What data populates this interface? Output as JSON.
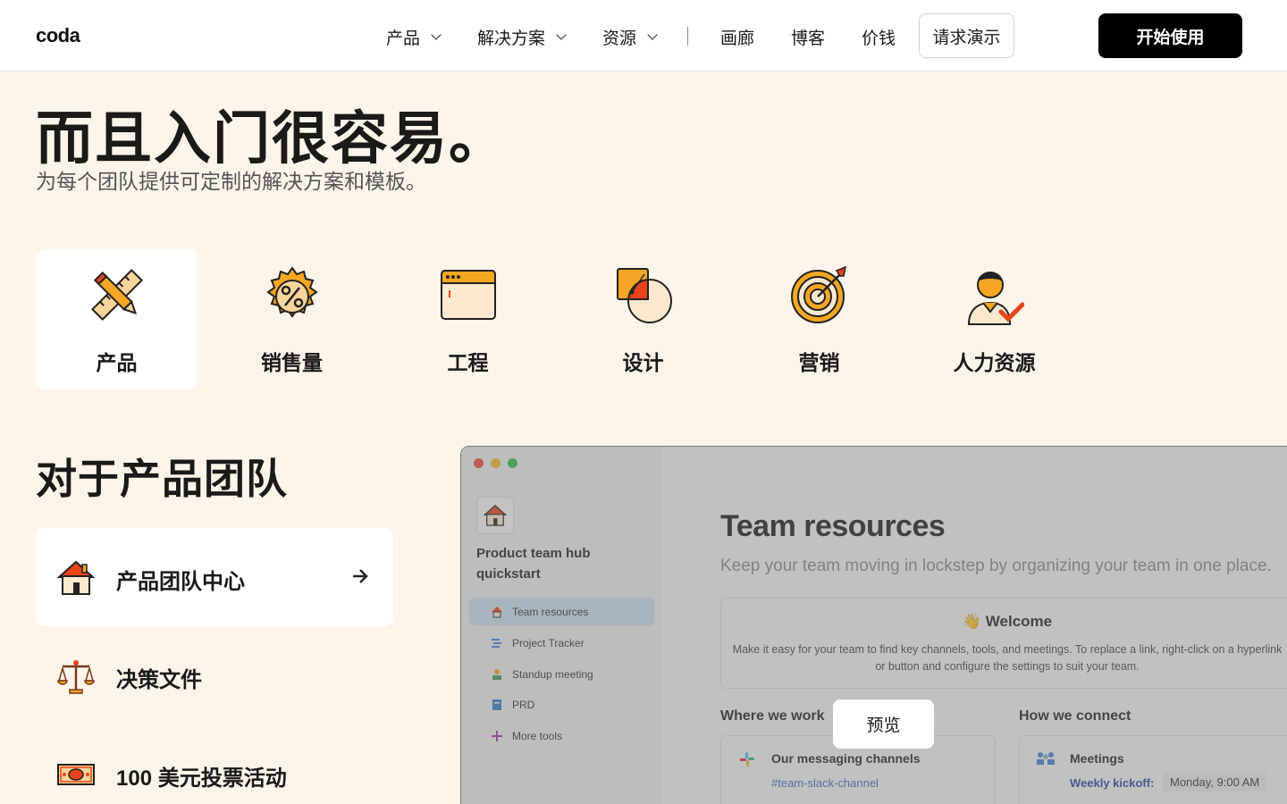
{
  "nav": {
    "logo": "coda",
    "items": [
      {
        "label": "产品"
      },
      {
        "label": "解决方案"
      },
      {
        "label": "资源"
      },
      {
        "label": "画廊"
      },
      {
        "label": "博客"
      },
      {
        "label": "价钱"
      }
    ],
    "demo_label": "请求演示",
    "start_label": "开始使用"
  },
  "hero": {
    "title": "而且入门很容易。",
    "subtitle": "为每个团队提供可定制的解决方案和模板。"
  },
  "categories": [
    {
      "label": "产品",
      "icon": "pencil-ruler-icon",
      "selected": true
    },
    {
      "label": "销售量",
      "icon": "percent-gear-icon"
    },
    {
      "label": "工程",
      "icon": "browser-window-icon"
    },
    {
      "label": "设计",
      "icon": "shapes-icon"
    },
    {
      "label": "营销",
      "icon": "target-icon"
    },
    {
      "label": "人力资源",
      "icon": "person-check-icon"
    }
  ],
  "section_title": "对于产品团队",
  "templates": [
    {
      "label": "产品团队中心",
      "icon": "house-icon",
      "selected": true
    },
    {
      "label": "决策文件",
      "icon": "scales-icon"
    },
    {
      "label": "100 美元投票活动",
      "icon": "money-icon"
    }
  ],
  "preview": {
    "hub_title": "Product team hub quickstart",
    "sidebar": [
      {
        "label": "Team resources",
        "icon": "house-icon",
        "selected": true
      },
      {
        "label": "Project Tracker",
        "icon": "list-icon"
      },
      {
        "label": "Standup meeting",
        "icon": "people-icon"
      },
      {
        "label": "PRD",
        "icon": "doc-icon"
      },
      {
        "label": "More tools",
        "icon": "plus-icon"
      }
    ],
    "title": "Team resources",
    "subtitle": "Keep your team moving in lockstep by organizing your team in one place.",
    "welcome_title": "👋 Welcome",
    "welcome_body": "Make it easy for your team to find key channels, tools, and meetings. To replace a link, right-click on a hyperlink or button and configure the settings to suit your team.",
    "where_heading": "Where we work",
    "how_heading": "How we connect",
    "channels_title": "Our messaging channels",
    "channels_link": "#team-slack-channel",
    "meetings_title": "Meetings",
    "meetings_key": "Weekly kickoff:",
    "meetings_value": "Monday, 9:00 AM",
    "preview_button": "预览"
  },
  "colors": {
    "page_bg": "#fdf4ea",
    "nav_bg": "#ffffff",
    "primary_button": "#000000",
    "accent_orange": "#f5a623",
    "accent_red": "#e8431a"
  }
}
